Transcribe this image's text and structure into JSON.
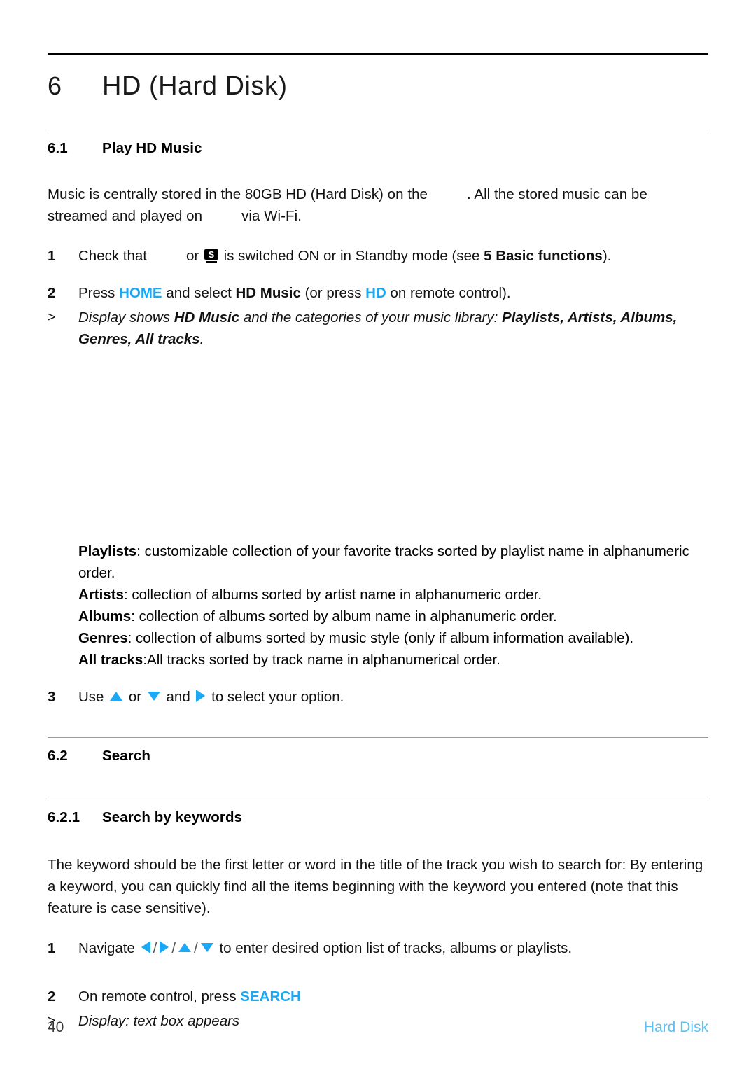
{
  "colors": {
    "accent_blue": "#1BA9F5",
    "footer_blue": "#5BC0F5",
    "rule_dark": "#000000",
    "rule_light": "#9a9a9a"
  },
  "chapter": {
    "number": "6",
    "title": "HD (Hard Disk)"
  },
  "sections": {
    "s61": {
      "number": "6.1",
      "title": "Play HD Music"
    },
    "s62": {
      "number": "6.2",
      "title": "Search"
    },
    "s621": {
      "number": "6.2.1",
      "title": "Search by keywords"
    }
  },
  "intro": {
    "part1": "Music is centrally stored in the 80GB HD (Hard Disk) on the",
    "part2": ". All the stored music can be streamed and played on",
    "part3": "via Wi-Fi."
  },
  "steps_61": {
    "step1": {
      "marker": "1",
      "text_a": "Check that",
      "text_b": "or",
      "icon": "standby-s-icon",
      "text_c": "is switched ON or in Standby mode (see",
      "bold_ref": "5 Basic functions",
      "text_d": ")."
    },
    "step2": {
      "marker": "2",
      "text_a": "Press",
      "key_home": "HOME",
      "text_b": "and select",
      "bold_b": "HD Music",
      "text_c": "(or press",
      "key_hd": "HD",
      "text_d": "on remote control)."
    },
    "result2": {
      "marker": ">",
      "text_a": "Display shows",
      "bold_a": "HD Music",
      "text_b": "and the categories of your music library:",
      "bold_list": "Playlists, Artists, Albums, Genres, All tracks",
      "text_c": "."
    },
    "step3": {
      "marker": "3",
      "text_a": "Use",
      "icon_up": "arrow-up-icon",
      "text_b": "or",
      "icon_down": "arrow-down-icon",
      "text_c": "and",
      "icon_right": "arrow-right-icon",
      "text_d": "to select your option."
    }
  },
  "categories": [
    {
      "name": "Playlists",
      "sep": ":",
      "desc": " customizable collection of your favorite tracks sorted by playlist name in alphanumeric order."
    },
    {
      "name": "Artists",
      "sep": ":",
      "desc": " collection of albums sorted by artist name in alphanumeric order."
    },
    {
      "name": "Albums",
      "sep": ":",
      "desc": " collection of albums sorted by album name in alphanumeric order."
    },
    {
      "name": "Genres",
      "sep": ":",
      "desc": " collection of albums sorted by music style (only if album information available)."
    },
    {
      "name": "All tracks",
      "sep": ":",
      "desc": "All tracks sorted by track name in alphanumerical order."
    }
  ],
  "keywords_para": "The keyword should be the first letter or word in the title of the track you wish to search for: By entering a keyword, you can quickly find all the items beginning with the keyword you entered (note that this feature is case sensitive).",
  "steps_621": {
    "step1": {
      "marker": "1",
      "text_a": "Navigate",
      "icon_left": "arrow-left-icon",
      "icon_right": "arrow-right-icon",
      "icon_up": "arrow-up-icon",
      "icon_down": "arrow-down-icon",
      "separator": "/",
      "text_b": "to enter desired option list of tracks, albums or playlists."
    },
    "step2": {
      "marker": "2",
      "text_a": "On remote control, press",
      "key_search": "SEARCH"
    },
    "result2": {
      "marker": ">",
      "text": "Display: text box appears"
    }
  },
  "footer": {
    "page_number": "40",
    "chapter_tag": "Hard Disk"
  }
}
